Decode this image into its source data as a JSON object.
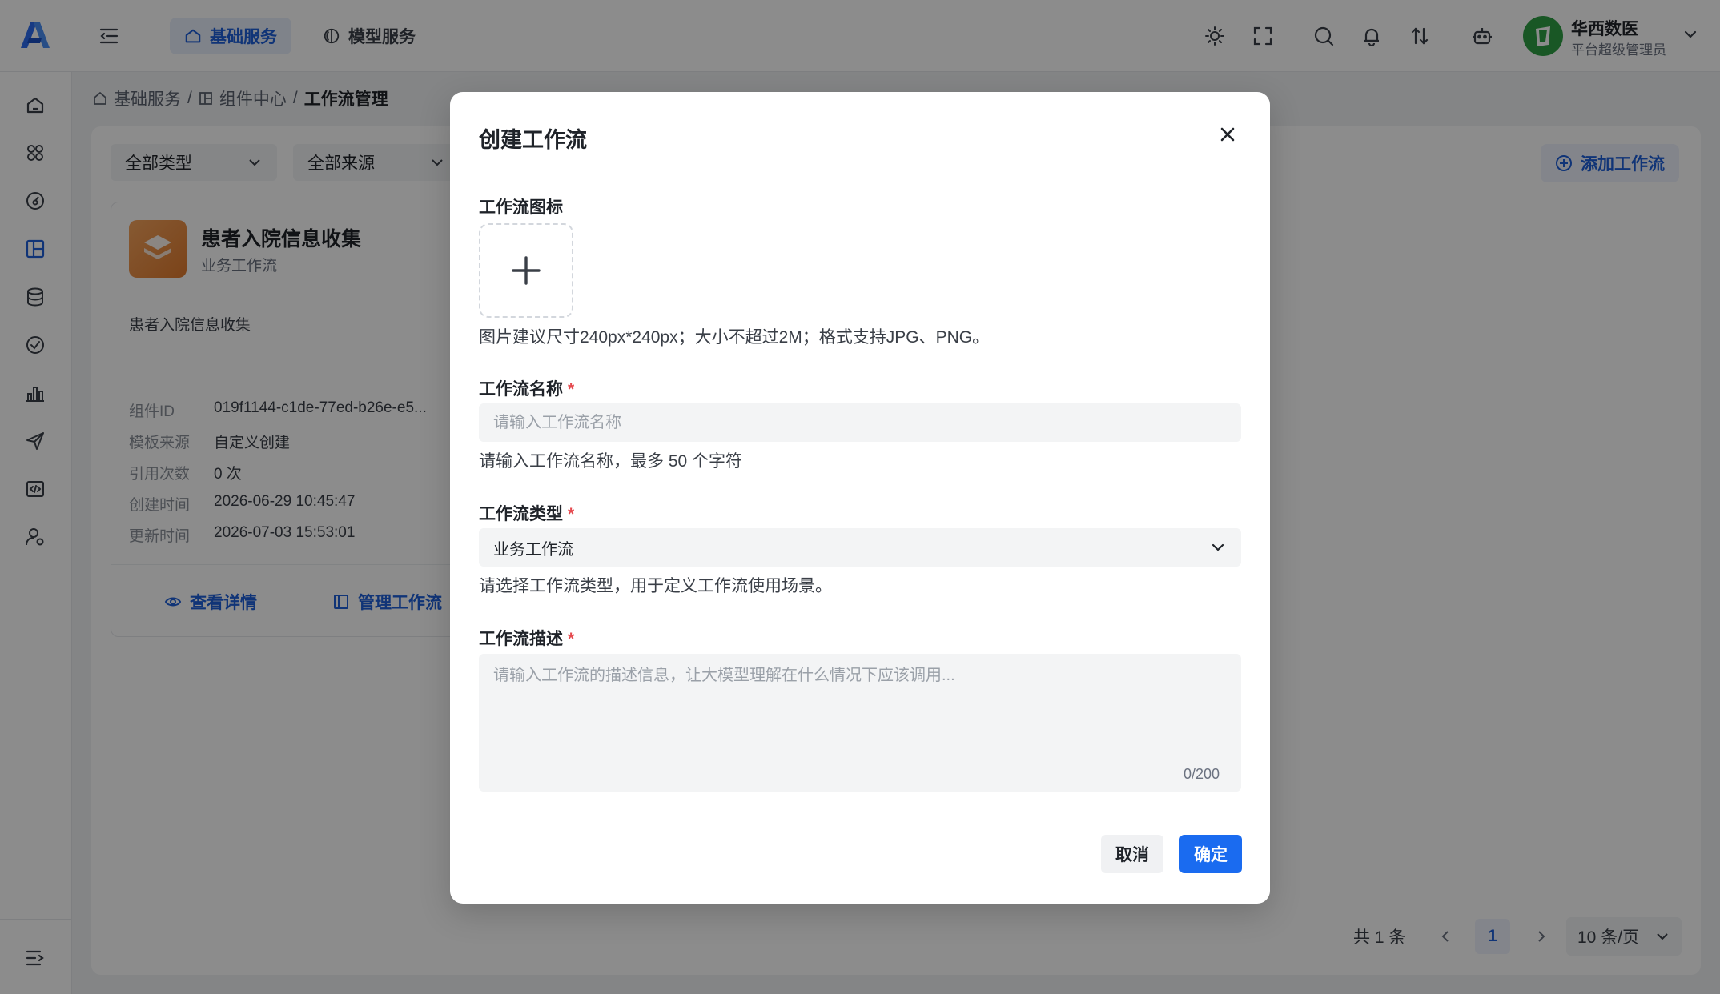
{
  "header": {
    "nav_tabs": [
      {
        "label": "基础服务",
        "icon": "home-icon",
        "active": true
      },
      {
        "label": "模型服务",
        "icon": "model-icon",
        "active": false
      }
    ],
    "user": {
      "name": "华西数医",
      "role": "平台超级管理员"
    },
    "icons": [
      "theme-icon",
      "fullscreen-icon",
      "search-icon",
      "bell-icon",
      "switch-icon",
      "bot-icon"
    ]
  },
  "sidebar": {
    "icons": [
      "home-icon",
      "apps-icon",
      "dashboard-icon",
      "component-icon",
      "database-icon",
      "check-icon",
      "chart-icon",
      "send-icon",
      "code-icon",
      "user-settings-icon"
    ]
  },
  "breadcrumb": {
    "items": [
      "基础服务",
      "组件中心",
      "工作流管理"
    ],
    "separator": "/"
  },
  "filters": {
    "type": "全部类型",
    "source": "全部来源"
  },
  "toolbar": {
    "add_label": "添加工作流"
  },
  "card": {
    "title": "患者入院信息收集",
    "subtitle": "业务工作流",
    "description": "患者入院信息收集",
    "meta": [
      {
        "label": "组件ID",
        "value": "019f1144-c1de-77ed-b26e-e5..."
      },
      {
        "label": "模板来源",
        "value": "自定义创建"
      },
      {
        "label": "引用次数",
        "value": "0 次"
      },
      {
        "label": "创建时间",
        "value": "2026-06-29 10:45:47"
      },
      {
        "label": "更新时间",
        "value": "2026-07-03 15:53:01"
      }
    ],
    "actions": {
      "detail": "查看详情",
      "manage": "管理工作流"
    }
  },
  "pagination": {
    "total": "共 1 条",
    "current_page": "1",
    "page_size": "10 条/页"
  },
  "modal": {
    "title": "创建工作流",
    "icon_label": "工作流图标",
    "icon_hint": "图片建议尺寸240px*240px；大小不超过2M；格式支持JPG、PNG。",
    "name_label": "工作流名称",
    "name_placeholder": "请输入工作流名称",
    "name_hint": "请输入工作流名称，最多 50 个字符",
    "type_label": "工作流类型",
    "type_value": "业务工作流",
    "type_hint": "请选择工作流类型，用于定义工作流使用场景。",
    "desc_label": "工作流描述",
    "desc_placeholder": "请输入工作流的描述信息，让大模型理解在什么情况下应该调用...",
    "desc_counter": "0/200",
    "required_mark": "*",
    "cancel_label": "取消",
    "ok_label": "确定"
  },
  "colors": {
    "accent": "#1a6bf0",
    "required": "#e5484d",
    "overlay": "rgba(0,0,0,0.45)"
  }
}
